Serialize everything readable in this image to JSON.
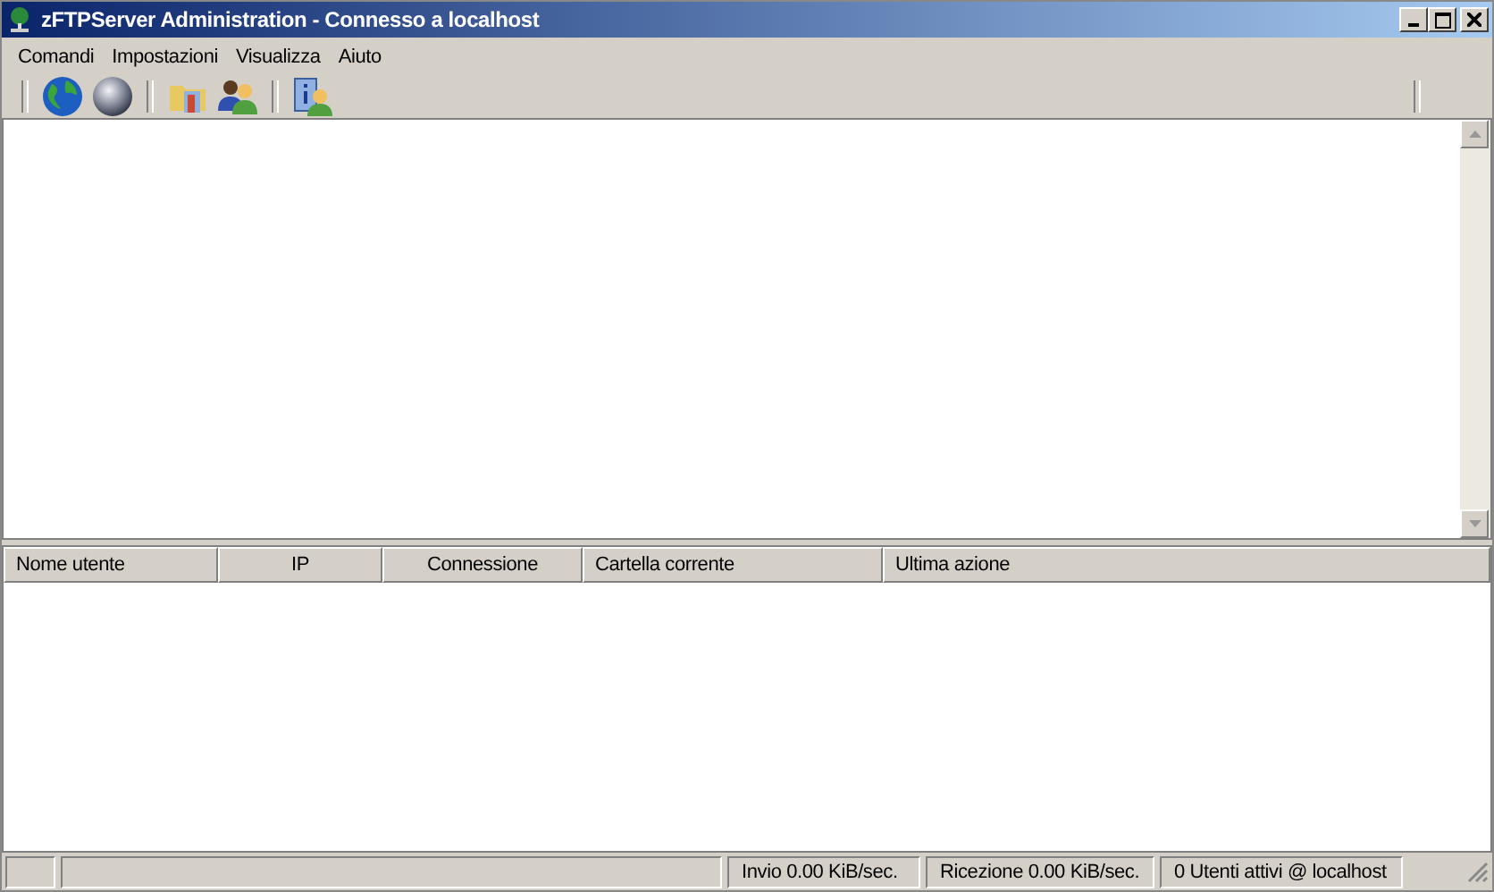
{
  "window": {
    "title": "zFTPServer Administration - Connesso a localhost"
  },
  "menu": [
    "Comandi",
    "Impostazioni",
    "Visualizza",
    "Aiuto"
  ],
  "toolbar": [
    {
      "kind": "separator"
    },
    {
      "kind": "globe"
    },
    {
      "kind": "sphere"
    },
    {
      "kind": "separator"
    },
    {
      "kind": "folder"
    },
    {
      "kind": "users"
    },
    {
      "kind": "separator"
    },
    {
      "kind": "info"
    },
    {
      "kind": "separator"
    }
  ],
  "table": {
    "columns": [
      "Nome utente",
      "IP",
      "Connessione",
      "Cartella corrente",
      "Ultima azione"
    ]
  },
  "status_bar": [
    "Invio 0.00 KiB/sec.",
    "Ricezione 0.00 KiB/sec.",
    "0 Utenti attivi @ localhost"
  ]
}
